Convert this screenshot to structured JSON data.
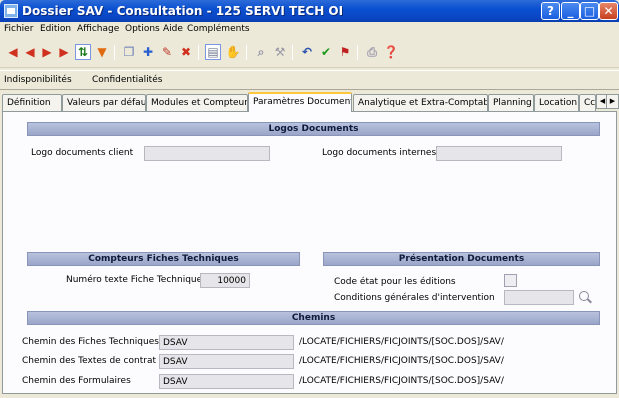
{
  "window": {
    "title": "Dossier SAV - Consultation - 125 SERVI TECH OI",
    "help_label": "?",
    "minimize_label": "_",
    "maximize_label": "□",
    "close_label": "✕"
  },
  "menu": [
    "Fichier",
    "Edition",
    "Affichage",
    "Options",
    "Aide",
    "Compléments"
  ],
  "toolbar": {
    "buttons": [
      {
        "icon": "first-record-icon",
        "glyph": "◀",
        "color": "#d0311f"
      },
      {
        "icon": "previous-record-icon",
        "glyph": "◀",
        "color": "#d0311f"
      },
      {
        "icon": "next-record-icon",
        "glyph": "▶",
        "color": "#d0311f"
      },
      {
        "icon": "last-record-icon",
        "glyph": "▶",
        "color": "#d0311f"
      },
      {
        "icon": "sort-icon",
        "glyph": "⇅",
        "color": "#1a7a1a"
      },
      {
        "icon": "filter-icon",
        "glyph": "▼",
        "color": "#e06a10"
      },
      {
        "icon": "copy-icon",
        "glyph": "❐",
        "color": "#6a7ab8"
      },
      {
        "icon": "add-icon",
        "glyph": "✚",
        "color": "#2a5fd0"
      },
      {
        "icon": "edit-icon",
        "glyph": "✎",
        "color": "#c0392b"
      },
      {
        "icon": "delete-icon",
        "glyph": "✖",
        "color": "#d0311f"
      },
      {
        "icon": "document-icon",
        "glyph": "▤",
        "color": "#707a90"
      },
      {
        "icon": "attach-icon",
        "glyph": "✋",
        "color": "#9a9aa8"
      },
      {
        "icon": "search-icon",
        "glyph": "⌕",
        "color": "#9a9aa8"
      },
      {
        "icon": "tools-icon",
        "glyph": "⚒",
        "color": "#9a9aa8"
      },
      {
        "icon": "undo-icon",
        "glyph": "↶",
        "color": "#2a4fb0"
      },
      {
        "icon": "validate-icon",
        "glyph": "✔",
        "color": "#1a9a1a"
      },
      {
        "icon": "flag-icon",
        "glyph": "⚑",
        "color": "#c02020"
      },
      {
        "icon": "print-icon",
        "glyph": "⎙",
        "color": "#a0a0b0"
      },
      {
        "icon": "help-icon",
        "glyph": "❓",
        "color": "#a0a0b0"
      }
    ]
  },
  "subbar": {
    "indispo": "Indisponibilités",
    "confid": "Confidentialités"
  },
  "tabs": [
    {
      "label": "Définition",
      "active": false
    },
    {
      "label": "Valeurs par défaut",
      "active": false
    },
    {
      "label": "Modules et Compteurs",
      "active": false
    },
    {
      "label": "Paramètres Documents",
      "active": true
    },
    {
      "label": "Analytique et Extra-Comptable",
      "active": false
    },
    {
      "label": "Planning",
      "active": false
    },
    {
      "label": "Location",
      "active": false
    },
    {
      "label": "Cc",
      "active": false
    }
  ],
  "tab_scroll": {
    "left": "◀",
    "right": "▶"
  },
  "logos": {
    "header": "Logos Documents",
    "client_label": "Logo documents client",
    "client_value": "",
    "internes_label": "Logo documents internes",
    "internes_value": ""
  },
  "compteurs": {
    "header": "Compteurs Fiches Techniques",
    "numero_label": "Numéro texte Fiche Technique",
    "numero_value": "10000"
  },
  "presentation": {
    "header": "Présentation Documents",
    "code_etat_label": "Code état pour les éditions",
    "conditions_label": "Conditions générales d'intervention",
    "conditions_value": ""
  },
  "chemins": {
    "header": "Chemins",
    "rows": [
      {
        "label": "Chemin des Fiches Techniques",
        "value": "DSAV",
        "path": "/LOCATE/FICHIERS/FICJOINTS/[SOC.DOS]/SAV/"
      },
      {
        "label": "Chemin des Textes de contrat",
        "value": "DSAV",
        "path": "/LOCATE/FICHIERS/FICJOINTS/[SOC.DOS]/SAV/"
      },
      {
        "label": "Chemin des Formulaires",
        "value": "DSAV",
        "path": "/LOCATE/FICHIERS/FICJOINTS/[SOC.DOS]/SAV/"
      }
    ]
  }
}
